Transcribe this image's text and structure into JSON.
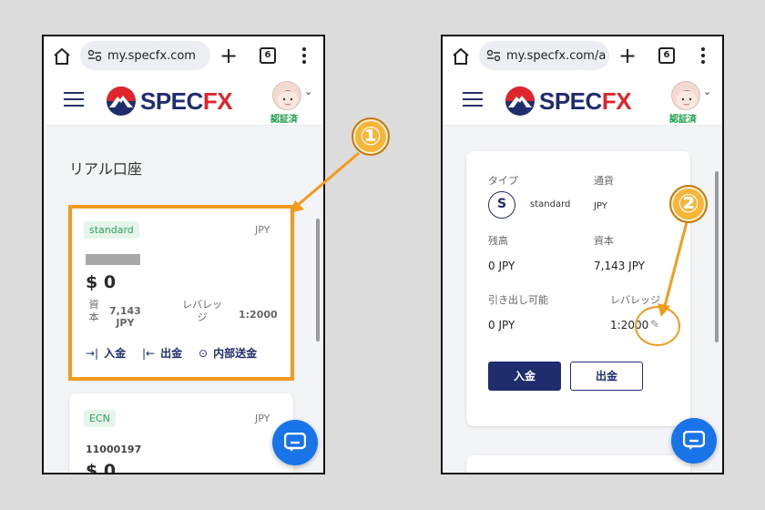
{
  "browser": {
    "left_url": "my.specfx.com",
    "right_url": "my.specfx.com/a",
    "tab_count": "6"
  },
  "app": {
    "brand_spec": "SPEC",
    "brand_fx": "FX",
    "verified_label": "認証済"
  },
  "left": {
    "page_title": "リアル口座",
    "card1": {
      "type_badge": "standard",
      "currency": "JPY",
      "balance": "$ 0",
      "capital_label": "資\n本",
      "capital_value": "7,143\nJPY",
      "leverage_label": "レバレッ\nジ",
      "leverage_value": "1:2000",
      "deposit_label": "入金",
      "withdraw_label": "出金",
      "transfer_label": "内部送金"
    },
    "card2": {
      "type_badge": "ECN",
      "currency": "JPY",
      "account_number": "11000197",
      "balance": "$ 0"
    }
  },
  "right": {
    "type_label": "タイプ",
    "type_icon_letter": "S",
    "type_value": "standard",
    "currency_label": "通貨",
    "currency_value": "JPY",
    "balance_label": "残高",
    "balance_value": "0 JPY",
    "capital_label": "資本",
    "capital_value": "7,143 JPY",
    "withdrawable_label": "引き出し可能",
    "withdrawable_value": "0 JPY",
    "leverage_label": "レバレッジ",
    "leverage_value": "1:2000",
    "deposit_button": "入金",
    "withdraw_button": "出金"
  },
  "annotations": {
    "callout_1": "①",
    "callout_2": "②",
    "highlight_color": "#f29b1d"
  },
  "colors": {
    "brand_navy": "#1f2d6e",
    "brand_red": "#e1252d",
    "chat_blue": "#1874e8",
    "badge_green": "#2f9e5b"
  }
}
